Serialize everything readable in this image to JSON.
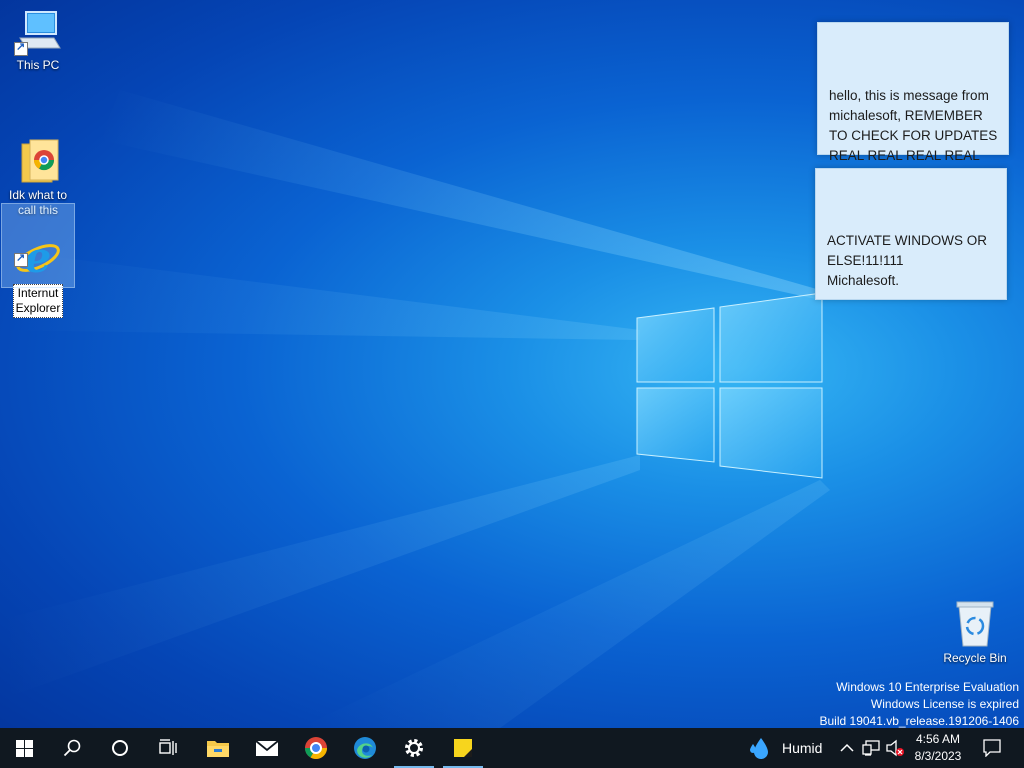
{
  "desktop": {
    "icons": [
      {
        "label": "This PC"
      },
      {
        "label": "Idk what to\ncall this"
      },
      {
        "label": "Internut\nExplorer"
      }
    ],
    "recycle_bin": {
      "label": "Recycle Bin"
    }
  },
  "sticky_notes": [
    {
      "text": "hello, this is message from\nmichalesoft, REMEMBER\nTO CHECK FOR UPDATES\nREAL REAL REAL REAL"
    },
    {
      "text": "ACTIVATE WINDOWS OR\nELSE!11!111\nMichalesoft."
    }
  ],
  "watermark": {
    "line1": "Windows 10 Enterprise Evaluation",
    "line2": "Windows License is expired",
    "line3": "Build 19041.vb_release.191206-1406"
  },
  "taskbar": {
    "buttons": [
      {
        "icon": "windows-start-icon"
      },
      {
        "icon": "search-icon"
      },
      {
        "icon": "cortana-icon"
      },
      {
        "icon": "task-view-icon"
      },
      {
        "icon": "file-explorer-icon"
      },
      {
        "icon": "mail-icon"
      },
      {
        "icon": "chrome-icon"
      },
      {
        "icon": "edge-icon"
      },
      {
        "icon": "settings-icon"
      },
      {
        "icon": "sticky-notes-icon"
      }
    ],
    "weather": {
      "label": "Humid"
    },
    "clock": {
      "time": "4:56 AM",
      "date": "8/3/2023"
    }
  },
  "colors": {
    "taskbar_bg": "#101820",
    "note_bg": "#d9ecfb",
    "active_indicator": "#76b9ed"
  }
}
